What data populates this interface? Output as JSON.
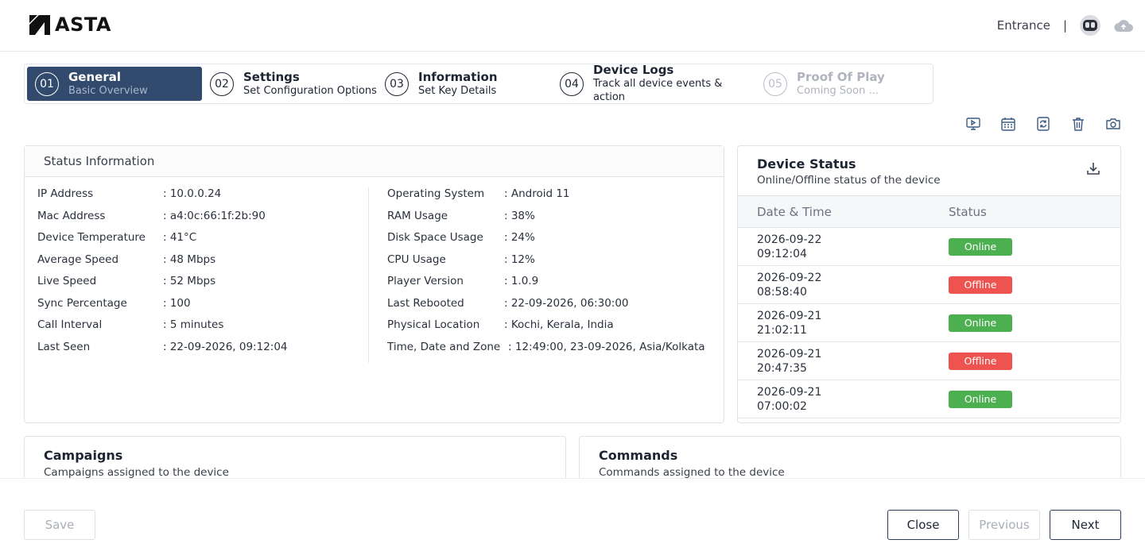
{
  "header": {
    "brand": "ASTA",
    "location": "Entrance",
    "separator": "|"
  },
  "stepper": {
    "steps": [
      {
        "number": "01",
        "title": "General",
        "subtitle": "Basic Overview",
        "state": "active"
      },
      {
        "number": "02",
        "title": "Settings",
        "subtitle": "Set Configuration Options",
        "state": "default"
      },
      {
        "number": "03",
        "title": "Information",
        "subtitle": "Set Key Details",
        "state": "default"
      },
      {
        "number": "04",
        "title": "Device Logs",
        "subtitle": "Track all device events & action",
        "state": "default"
      },
      {
        "number": "05",
        "title": "Proof Of Play",
        "subtitle": "Coming Soon ...",
        "state": "disabled"
      }
    ]
  },
  "toolbar": {
    "icons": [
      "remote-screen-icon",
      "calendar-icon",
      "refresh-icon",
      "trash-icon",
      "camera-icon"
    ]
  },
  "status_info": {
    "title": "Status Information",
    "left": [
      {
        "label": "IP Address",
        "value": ": 10.0.0.24"
      },
      {
        "label": "Mac Address",
        "value": ": a4:0c:66:1f:2b:90"
      },
      {
        "label": "Device Temperature",
        "value": ": 41°C"
      },
      {
        "label": "Average Speed",
        "value": ": 48 Mbps"
      },
      {
        "label": "Live Speed",
        "value": ": 52 Mbps"
      },
      {
        "label": "Sync Percentage",
        "value": ": 100"
      },
      {
        "label": "Call Interval",
        "value": ": 5 minutes"
      },
      {
        "label": "Last Seen",
        "value": ": 22-09-2026, 09:12:04"
      }
    ],
    "right": [
      {
        "label": "Operating System",
        "value": ": Android 11"
      },
      {
        "label": "RAM Usage",
        "value": ": 38%"
      },
      {
        "label": "Disk Space Usage",
        "value": ": 24%"
      },
      {
        "label": "CPU Usage",
        "value": ": 12%"
      },
      {
        "label": "Player Version",
        "value": ": 1.0.9"
      },
      {
        "label": "Last Rebooted",
        "value": ": 22-09-2026, 06:30:00"
      },
      {
        "label": "Physical Location",
        "value": ": Kochi, Kerala, India"
      },
      {
        "label": "Time, Date and Zone",
        "value": ": 12:49:00, 23-09-2026, Asia/Kolkata"
      }
    ]
  },
  "device_status": {
    "title": "Device Status",
    "subtitle": "Online/Offline status of the device",
    "columns": [
      "Date & Time",
      "Status"
    ],
    "rows": [
      {
        "date": "2026-09-22",
        "time": "09:12:04",
        "status": "Online"
      },
      {
        "date": "2026-09-22",
        "time": "08:58:40",
        "status": "Offline"
      },
      {
        "date": "2026-09-21",
        "time": "21:02:11",
        "status": "Online"
      },
      {
        "date": "2026-09-21",
        "time": "20:47:35",
        "status": "Offline"
      },
      {
        "date": "2026-09-21",
        "time": "07:00:02",
        "status": "Online"
      }
    ],
    "status_colors": {
      "Online": "#4caf50",
      "Offline": "#ef5350"
    }
  },
  "campaigns": {
    "title": "Campaigns",
    "subtitle": "Campaigns assigned to the device"
  },
  "commands": {
    "title": "Commands",
    "subtitle": "Commands assigned to the device"
  },
  "footer": {
    "save": "Save",
    "close": "Close",
    "previous": "Previous",
    "next": "Next"
  },
  "colors": {
    "accent": "#324a6d"
  }
}
